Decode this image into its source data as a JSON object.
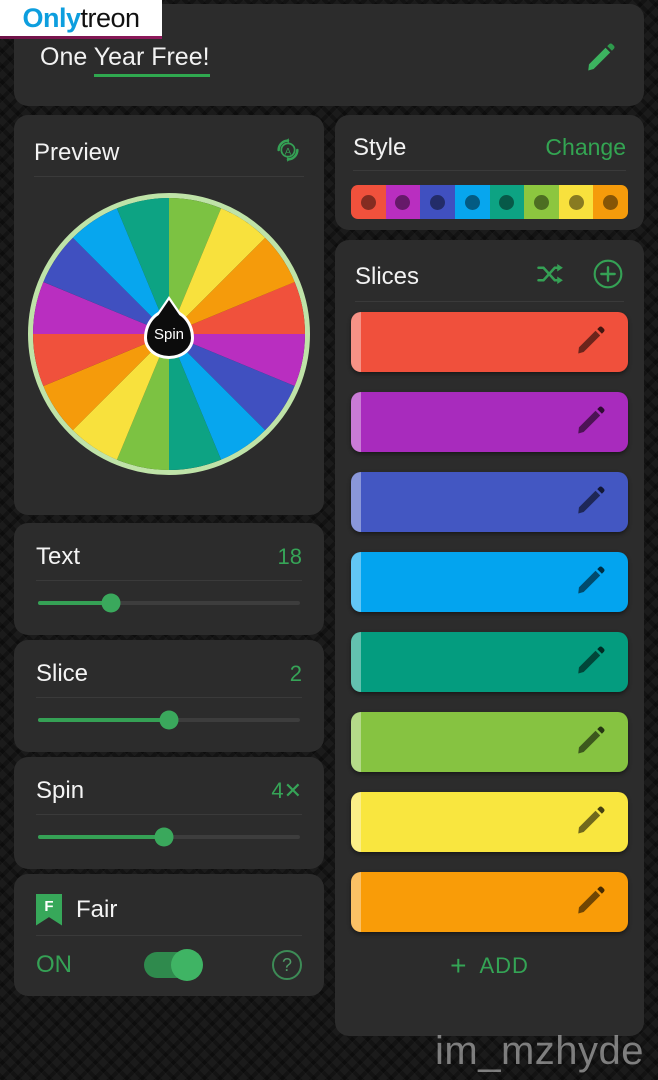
{
  "watermark_logo": {
    "part1": "Only",
    "part2": "treon"
  },
  "watermark_text": "im_mzhyde",
  "header": {
    "title_plain": "One ",
    "title_underlined": "Year Free!",
    "edit_icon": "pencil-icon"
  },
  "preview": {
    "title": "Preview",
    "auto_icon": "auto-rotate-icon",
    "auto_letter": "A",
    "spin_label": "Spin",
    "wheel_slice_count": 16,
    "wheel_colors": [
      "#f0513c",
      "#b92ec0",
      "#4050c0",
      "#07a6ee",
      "#0da383",
      "#7cc242",
      "#f8e13d",
      "#f59b0b",
      "#f0513c",
      "#b92ec0",
      "#4050c0",
      "#07a6ee",
      "#0da383",
      "#7cc242",
      "#f8e13d",
      "#f59b0b"
    ]
  },
  "sliders": [
    {
      "name": "Text",
      "value": "18",
      "percent": 28
    },
    {
      "name": "Slice",
      "value": "2",
      "percent": 50
    },
    {
      "name": "Spin",
      "value": "4✕",
      "percent": 48
    }
  ],
  "fair": {
    "badge_letter": "F",
    "badge_icon": "bookmark-icon",
    "label": "Fair",
    "state": "ON",
    "toggle_on": true,
    "help_icon": "question-mark-icon",
    "help_glyph": "?"
  },
  "style": {
    "title": "Style",
    "change_label": "Change",
    "palette": [
      "#f0513c",
      "#b92ec0",
      "#4050c0",
      "#07a6ee",
      "#0da383",
      "#8cc63f",
      "#f8e13d",
      "#f59b0b"
    ]
  },
  "slices": {
    "title": "Slices",
    "shuffle_icon": "shuffle-icon",
    "add_icon": "plus-circle-icon",
    "items": [
      {
        "color": "#f0503c",
        "label": "",
        "edit_icon": "pencil-icon"
      },
      {
        "color": "#a82bbd",
        "label": "",
        "edit_icon": "pencil-icon"
      },
      {
        "color": "#4357c2",
        "label": "",
        "edit_icon": "pencil-icon"
      },
      {
        "color": "#03a4ef",
        "label": "",
        "edit_icon": "pencil-icon"
      },
      {
        "color": "#049c7f",
        "label": "",
        "edit_icon": "pencil-icon"
      },
      {
        "color": "#86c341",
        "label": "",
        "edit_icon": "pencil-icon"
      },
      {
        "color": "#f9e63f",
        "label": "",
        "edit_icon": "pencil-icon"
      },
      {
        "color": "#f99c08",
        "label": "",
        "edit_icon": "pencil-icon"
      }
    ],
    "add_plus": "+",
    "add_label": "ADD"
  },
  "colors": {
    "accent_green": "#34a455",
    "card_bg": "#2c2c2c",
    "page_bg": "#1b1b1b"
  }
}
